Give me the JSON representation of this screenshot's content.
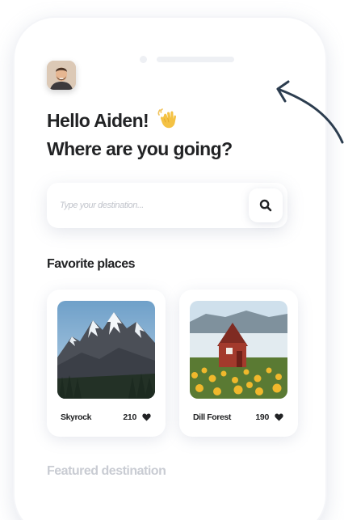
{
  "user": {
    "greeting": "Hello Aiden!",
    "greeting_emoji": "waving-hand",
    "question": "Where are you going?"
  },
  "search": {
    "placeholder": "Type your destination..."
  },
  "favorites": {
    "title": "Favorite places",
    "items": [
      {
        "name": "Skyrock",
        "likes": "210"
      },
      {
        "name": "Dill Forest",
        "likes": "190"
      }
    ]
  },
  "featured": {
    "title": "Featured destination"
  },
  "colors": {
    "text": "#222325",
    "muted": "#c9ccd3",
    "placeholder": "#c2c5cc",
    "arrow": "#2c3d4f"
  }
}
